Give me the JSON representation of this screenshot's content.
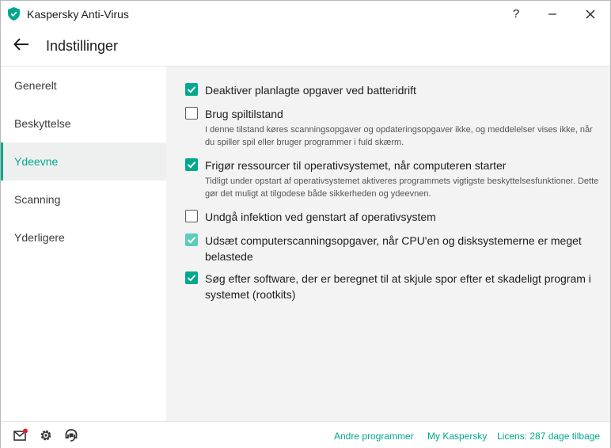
{
  "window": {
    "title": "Kaspersky Anti-Virus"
  },
  "titlebar": {
    "help_label": "?",
    "minimize_label": "—",
    "close_label": "✕"
  },
  "header": {
    "title": "Indstillinger"
  },
  "sidebar": {
    "items": [
      {
        "label": "Generelt",
        "active": false
      },
      {
        "label": "Beskyttelse",
        "active": false
      },
      {
        "label": "Ydeevne",
        "active": true
      },
      {
        "label": "Scanning",
        "active": false
      },
      {
        "label": "Yderligere",
        "active": false
      }
    ]
  },
  "options": [
    {
      "label": "Deaktiver planlagte opgaver ved batteridrift",
      "checked": true,
      "description": ""
    },
    {
      "label": "Brug spiltilstand",
      "checked": false,
      "description": "I denne tilstand køres scanningsopgaver og opdateringsopgaver ikke, og meddelelser vises ikke, når du spiller spil eller bruger programmer i fuld skærm."
    },
    {
      "label": "Frigør ressourcer til operativsystemet, når computeren starter",
      "checked": true,
      "description": "Tidligt under opstart af operativsystemet aktiveres programmets vigtigste beskyttelsesfunktioner. Dette gør det muligt at tilgodese både sikkerheden og ydeevnen."
    },
    {
      "label": "Undgå infektion ved genstart af operativsystem",
      "checked": false,
      "description": ""
    },
    {
      "label": "Udsæt computerscanningsopgaver, når CPU'en og disksystemerne er meget belastede",
      "checked": true,
      "disabled": true,
      "description": ""
    },
    {
      "label": "Søg efter software, der er beregnet til at skjule spor efter et skadeligt program i systemet (rootkits)",
      "checked": true,
      "description": ""
    }
  ],
  "footer": {
    "links": {
      "other_programs": "Andre programmer",
      "my_kaspersky": "My Kaspersky",
      "license": "Licens: 287 dage tilbage"
    }
  },
  "colors": {
    "accent": "#00a88e",
    "accent_disabled": "#5bcdb9",
    "notification_dot": "#e0202e"
  }
}
